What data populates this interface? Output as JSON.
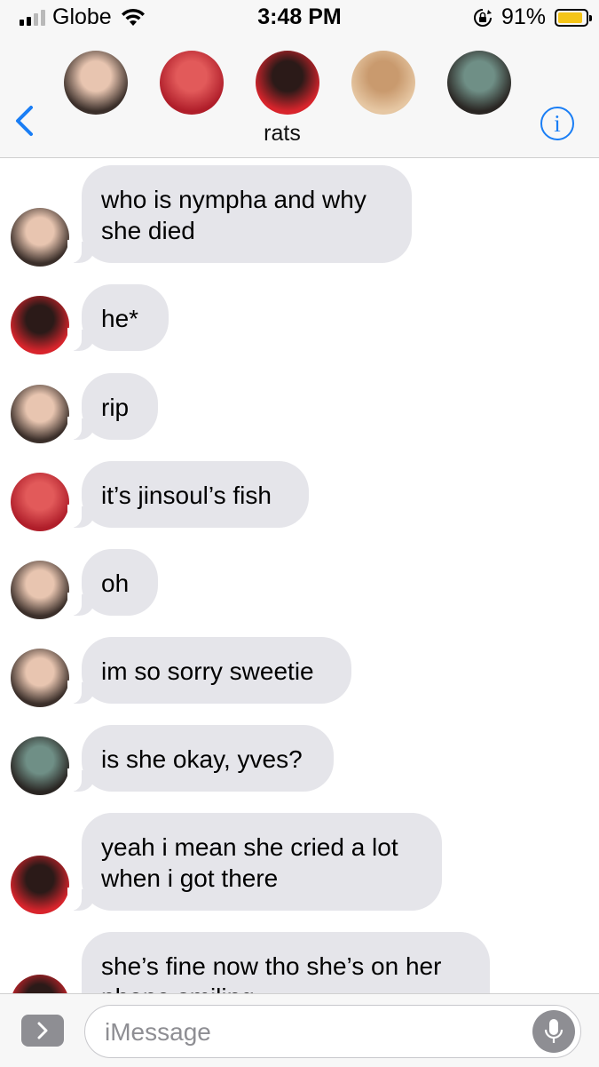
{
  "status_bar": {
    "carrier": "Globe",
    "time": "3:48 PM",
    "battery": "91%",
    "battery_level": 0.91,
    "signal_bars": 4,
    "signal_bars_filled": 2
  },
  "header": {
    "group_name": "rats",
    "back_icon": "chevron-left-icon",
    "info_icon": "info-icon",
    "info_glyph": "i",
    "participants": [
      {
        "name": "participant-1",
        "colors": [
          "#3b2f2a",
          "#e8c5b0"
        ]
      },
      {
        "name": "participant-2",
        "colors": [
          "#b01e2a",
          "#e25a5a"
        ]
      },
      {
        "name": "participant-3",
        "colors": [
          "#d8242c",
          "#2b1a18"
        ]
      },
      {
        "name": "participant-4",
        "colors": [
          "#e6c7a3",
          "#c99a6e"
        ]
      },
      {
        "name": "participant-5",
        "colors": [
          "#2a2623",
          "#6f8f86"
        ]
      }
    ]
  },
  "messages": [
    {
      "sender": "participant-1",
      "text": "who is nympha and why\nshe died"
    },
    {
      "sender": "participant-3",
      "text": "he*"
    },
    {
      "sender": "participant-1",
      "text": "rip"
    },
    {
      "sender": "participant-2",
      "text": "it’s jinsoul’s fish"
    },
    {
      "sender": "participant-1",
      "text": "oh"
    },
    {
      "sender": "participant-1",
      "text": "im so sorry sweetie"
    },
    {
      "sender": "participant-5",
      "text": "is she okay, yves?"
    },
    {
      "sender": "participant-3",
      "text": "yeah i mean she cried a lot\nwhen i got there"
    },
    {
      "sender": "participant-3",
      "text": "she’s fine now tho she’s on her\nphone smiling"
    }
  ],
  "input": {
    "placeholder": "iMessage",
    "value": "",
    "expand_icon": "chevron-right-icon",
    "mic_icon": "microphone-icon"
  },
  "colors": {
    "accent": "#1a7ef5",
    "bubble_incoming": "#e5e5ea",
    "bar_background": "#f7f7f7"
  }
}
